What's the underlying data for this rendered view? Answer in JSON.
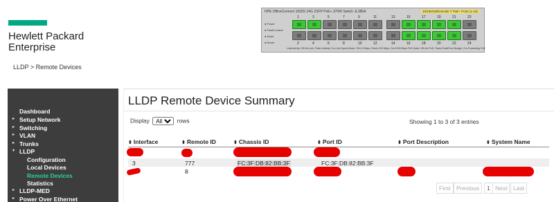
{
  "brand": {
    "line1": "Hewlett Packard",
    "line2": "Enterprise",
    "color": "#01a982"
  },
  "breadcrumb": "LLDP > Remote Devices",
  "switch": {
    "model": "HPE OfficeConnect 1920S 24G 2SFP PoE+ 370W Switch JL385A",
    "badge": "10/100/1000 BASE-T PoE+ Ports (1-24)",
    "leds": [
      "Power",
      "Fault/Locator",
      "Mode",
      "Reset"
    ],
    "legend": "Link/Activity: Off=No Link, Flash=Activity, On=Link   Speed Mode: Off=10 Mbps, Flash=100 Mbps, On=1000 Mbps   PoE Mode: Off=No PoE, Flash=Fault/Over Budget, On=Forwarding PoE",
    "top_numbers": [
      "1",
      "3",
      "5",
      "7",
      "9",
      "11",
      "13",
      "15",
      "17",
      "19",
      "21",
      "23"
    ],
    "bottom_numbers": [
      "2",
      "4",
      "6",
      "8",
      "10",
      "12",
      "14",
      "16",
      "18",
      "20",
      "22",
      "24"
    ],
    "active_ports": [
      "1",
      "3",
      "15",
      "17",
      "19",
      "21",
      "16",
      "18",
      "20",
      "22"
    ]
  },
  "sidebar": {
    "items": [
      {
        "label": "Dashboard",
        "arrow": ""
      },
      {
        "label": "Setup Network",
        "arrow": "▸"
      },
      {
        "label": "Switching",
        "arrow": "▸"
      },
      {
        "label": "VLAN",
        "arrow": "▸"
      },
      {
        "label": "Trunks",
        "arrow": "▸"
      },
      {
        "label": "LLDP",
        "arrow": "▾"
      },
      {
        "label": "LLDP-MED",
        "arrow": "▸"
      },
      {
        "label": "Power Over Ethernet",
        "arrow": "▸"
      }
    ],
    "lldp_sub": [
      "Configuration",
      "Local Devices",
      "Remote Devices",
      "Statistics"
    ],
    "active_color": "#2ad2a0"
  },
  "main": {
    "title": "LLDP Remote Device Summary",
    "display_prefix": "Display",
    "display_value": "All",
    "display_suffix": "rows",
    "entries": "Showing 1 to 3 of 3 entries",
    "columns": [
      "Interface",
      "Remote ID",
      "Chassis ID",
      "Port ID",
      "Port Description",
      "System Name"
    ],
    "rows": [
      {
        "interface": "3",
        "remote_id": "777",
        "chassis_id": "FC:3F:DB:82:BB:3F",
        "port_id": "FC:3F:DB:82:BB:3F"
      },
      {
        "remote_id": "8"
      }
    ],
    "pager": [
      "First",
      "Previous",
      "1",
      "Next",
      "Last"
    ]
  }
}
